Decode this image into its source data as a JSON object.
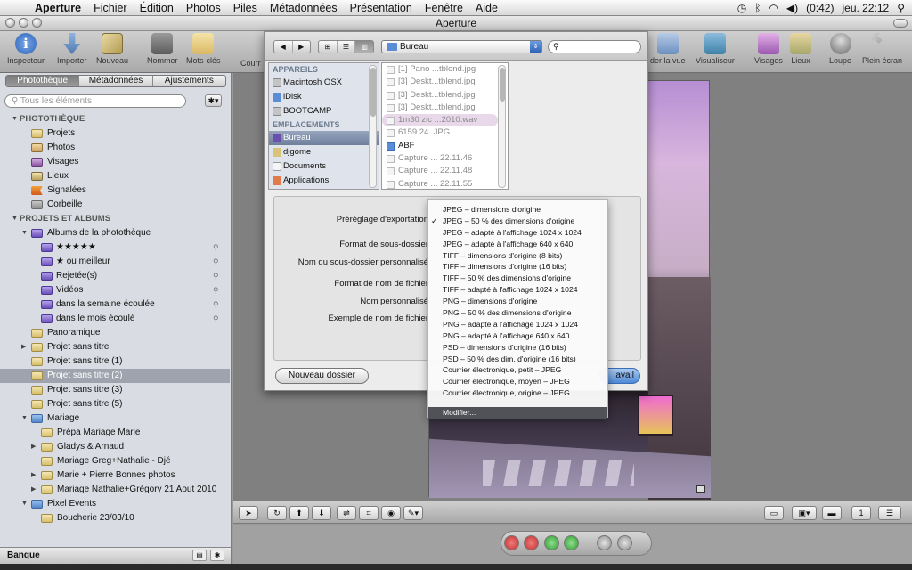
{
  "menubar": {
    "items": [
      "Aperture",
      "Fichier",
      "Édition",
      "Photos",
      "Piles",
      "Métadonnées",
      "Présentation",
      "Fenêtre",
      "Aide"
    ],
    "battery": "(0:42)",
    "clock": "jeu. 22:12"
  },
  "window": {
    "title": "Aperture"
  },
  "toolbar": {
    "inspector": "Inspecteur",
    "import": "Importer",
    "new": "Nouveau",
    "name": "Nommer",
    "keywords": "Mots-clés",
    "courr": "Courr",
    "view": "der la vue",
    "viewer": "Visualiseur",
    "faces": "Visages",
    "places": "Lieux",
    "loupe": "Loupe",
    "fullscreen": "Plein écran"
  },
  "sidebar": {
    "tabs": [
      "Photothèque",
      "Métadonnées",
      "Ajustements"
    ],
    "search_placeholder": "Tous les éléments",
    "library_header": "PHOTOTHÈQUE",
    "library": [
      "Projets",
      "Photos",
      "Visages",
      "Lieux",
      "Signalées",
      "Corbeille"
    ],
    "projects_header": "PROJETS ET ALBUMS",
    "albums_parent": "Albums de la photothèque",
    "albums": [
      "★★★★★",
      "★ ou meilleur",
      "Rejetée(s)",
      "Vidéos",
      "dans la semaine écoulée",
      "dans le mois écoulé"
    ],
    "items": [
      "Panoramique",
      "Projet sans titre",
      "Projet sans titre (1)",
      "Projet sans titre (2)",
      "Projet sans titre (3)",
      "Projet sans titre (5)"
    ],
    "mariage": "Mariage",
    "mariage_items": [
      "Prépa Mariage Marie",
      "Gladys & Arnaud",
      "Mariage Greg+Nathalie - Djé",
      "Marie + Pierre Bonnes photos",
      "Mariage Nathalie+Grégory 21 Aout 2010"
    ],
    "pixel": "Pixel Events",
    "pixel_items": [
      "Boucherie 23/03/10"
    ],
    "footer": "Banque"
  },
  "dialog": {
    "location": "Bureau",
    "devices_header": "APPAREILS",
    "devices": [
      "Macintosh OSX",
      "iDisk",
      "BOOTCAMP"
    ],
    "places_header": "EMPLACEMENTS",
    "places": [
      "Bureau",
      "djgome",
      "Documents",
      "Applications"
    ],
    "files": [
      "[1] Pano ...tblend.jpg",
      "[3] Deskt...tblend.jpg",
      "[3] Deskt...tblend.jpg",
      "[3] Deskt...tblend.jpg",
      "1m30 zic ...2010.wav",
      "6159 24 .JPG",
      "ABF",
      "Capture ... 22.11.46",
      "Capture ... 22.11.48",
      "Capture ... 22.11.55"
    ],
    "labels": {
      "preset": "Préréglage d'exportation",
      "subfolder_format": "Format de sous-dossier",
      "subfolder_name": "Nom du sous-dossier personnalisé",
      "filename_format": "Format de nom de fichier",
      "custom_name": "Nom personnalisé",
      "example": "Exemple de nom de fichier"
    },
    "new_folder": "Nouveau dossier",
    "save": "avail"
  },
  "preset_menu": {
    "items": [
      "JPEG – dimensions d'origine",
      "JPEG – 50 % des dimensions d'origine",
      "JPEG – adapté à l'affichage 1024 x 1024",
      "JPEG – adapté à l'affichage 640 x 640",
      "TIFF – dimensions d'origine (8 bits)",
      "TIFF – dimensions d'origine (16 bits)",
      "TIFF – 50 % des dimensions d'origine",
      "TIFF – adapté à l'affichage 1024 x 1024",
      "PNG – dimensions d'origine",
      "PNG – 50 % des dimensions d'origine",
      "PNG – adapté à l'affichage 1024 x 1024",
      "PNG – adapté à l'affichage 640 x 640",
      "PSD – dimensions d'origine (16 bits)",
      "PSD – 50 % des dim. d'origine (16 bits)",
      "Courrier électronique, petit – JPEG",
      "Courrier électronique, moyen – JPEG",
      "Courrier électronique, origine – JPEG"
    ],
    "checked": "✓",
    "edit": "Modifier..."
  },
  "colors": {
    "selection": "#9ea3ad",
    "menu_hover": "#505257"
  }
}
